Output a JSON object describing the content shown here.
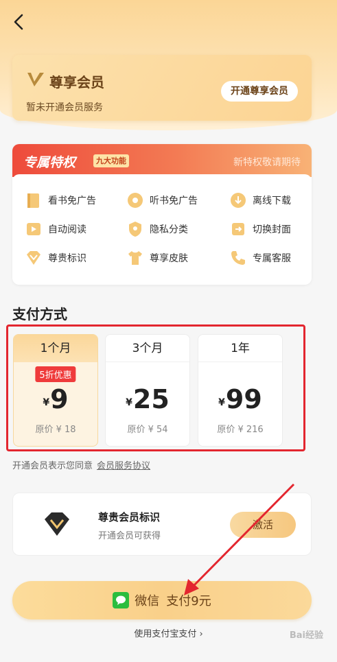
{
  "header": {
    "back_icon": "chevron-left-icon"
  },
  "member": {
    "title": "尊享会员",
    "subtitle": "暂未开通会员服务",
    "open_button": "开通尊享会员"
  },
  "privileges": {
    "title": "专属特权",
    "badge": "九大功能",
    "hint": "新特权敬请期待",
    "items": [
      {
        "label": "看书免广告",
        "icon": "book-icon"
      },
      {
        "label": "听书免广告",
        "icon": "disc-icon"
      },
      {
        "label": "离线下载",
        "icon": "cloud-download-icon"
      },
      {
        "label": "自动阅读",
        "icon": "play-icon"
      },
      {
        "label": "隐私分类",
        "icon": "shield-icon"
      },
      {
        "label": "切换封面",
        "icon": "cover-switch-icon"
      },
      {
        "label": "尊贵标识",
        "icon": "diamond-icon"
      },
      {
        "label": "尊享皮肤",
        "icon": "shirt-icon"
      },
      {
        "label": "专属客服",
        "icon": "phone-icon"
      }
    ]
  },
  "payment": {
    "section_title": "支付方式",
    "plans": [
      {
        "name": "1个月",
        "discount": "5折优惠",
        "currency": "¥",
        "price": "9",
        "original": "原价 ¥ 18",
        "selected": true
      },
      {
        "name": "3个月",
        "discount": "",
        "currency": "¥",
        "price": "25",
        "original": "原价 ¥ 54",
        "selected": false
      },
      {
        "name": "1年",
        "discount": "",
        "currency": "¥",
        "price": "99",
        "original": "原价 ¥ 216",
        "selected": false
      }
    ],
    "agreement_text": "开通会员表示您同意",
    "agreement_link": "会员服务协议"
  },
  "badge_card": {
    "title": "尊贵会员标识",
    "subtitle": "开通会员可获得",
    "button": "激活"
  },
  "pay_button": {
    "method": "微信",
    "label": "支付9元"
  },
  "alipay_link": "使用支付宝支付 ›",
  "watermark": "Bai经验",
  "colors": {
    "accent": "#f9d08a",
    "brand_red": "#ee4b3b",
    "highlight_border": "#e3262f"
  }
}
